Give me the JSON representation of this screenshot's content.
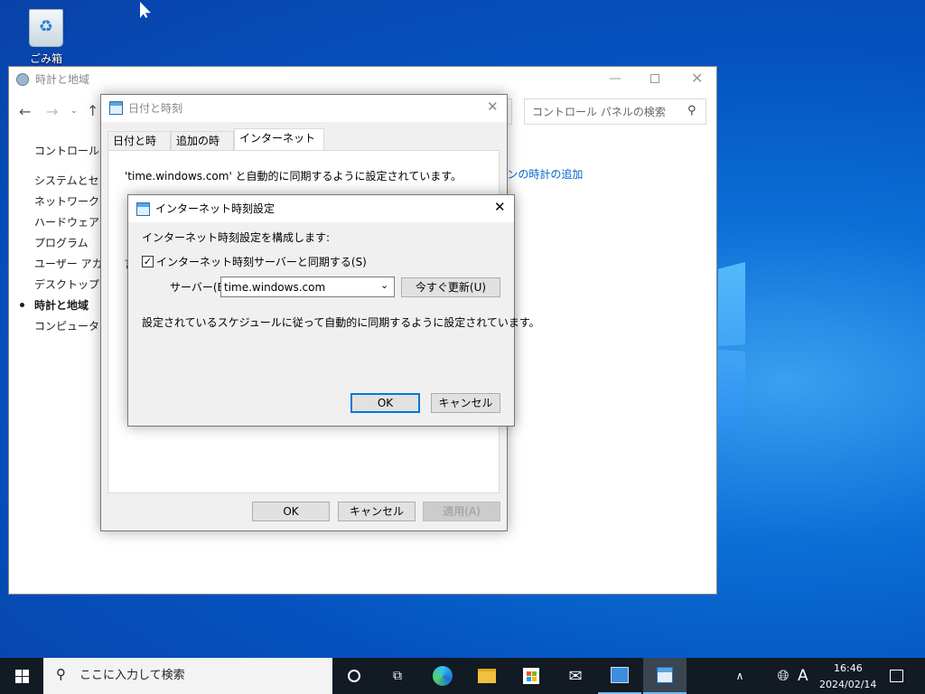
{
  "desktop": {
    "recycle_bin_label": "ごみ箱"
  },
  "control_panel": {
    "title": "時計と地域",
    "search_placeholder": "コントロール パネルの検索",
    "sidebar_header": "コントロール パネ",
    "sidebar_items": [
      "システムとセキュ",
      "ネットワークとイ",
      "ハードウェアとサ",
      "プログラム",
      "ユーザー アカウン",
      "デスクトップのカ",
      "時計と地域",
      "コンピューターの"
    ],
    "active_item": "時計と地域",
    "link_partial": "ーンの時計の追加"
  },
  "datetime_dialog": {
    "title": "日付と時刻",
    "tabs": [
      "日付と時刻",
      "追加の時計",
      "インターネット時刻"
    ],
    "selected_tab": "インターネット時刻",
    "status_text": "'time.windows.com' と自動的に同期するように設定されています。",
    "partial_text": "言",
    "ok": "OK",
    "cancel": "キャンセル",
    "apply": "適用(A)"
  },
  "internet_time_dialog": {
    "title": "インターネット時刻設定",
    "heading": "インターネット時刻設定を構成します:",
    "sync_checkbox_label": "インターネット時刻サーバーと同期する(S)",
    "sync_checked": true,
    "server_label": "サーバー(E):",
    "server_value": "time.windows.com",
    "update_now": "今すぐ更新(U)",
    "schedule_text": "設定されているスケジュールに従って自動的に同期するように設定されています。",
    "ok": "OK",
    "cancel": "キャンセル"
  },
  "taskbar": {
    "search_placeholder": "ここに入力して検索",
    "ime": "A",
    "time": "16:46",
    "date": "2024/02/14"
  }
}
